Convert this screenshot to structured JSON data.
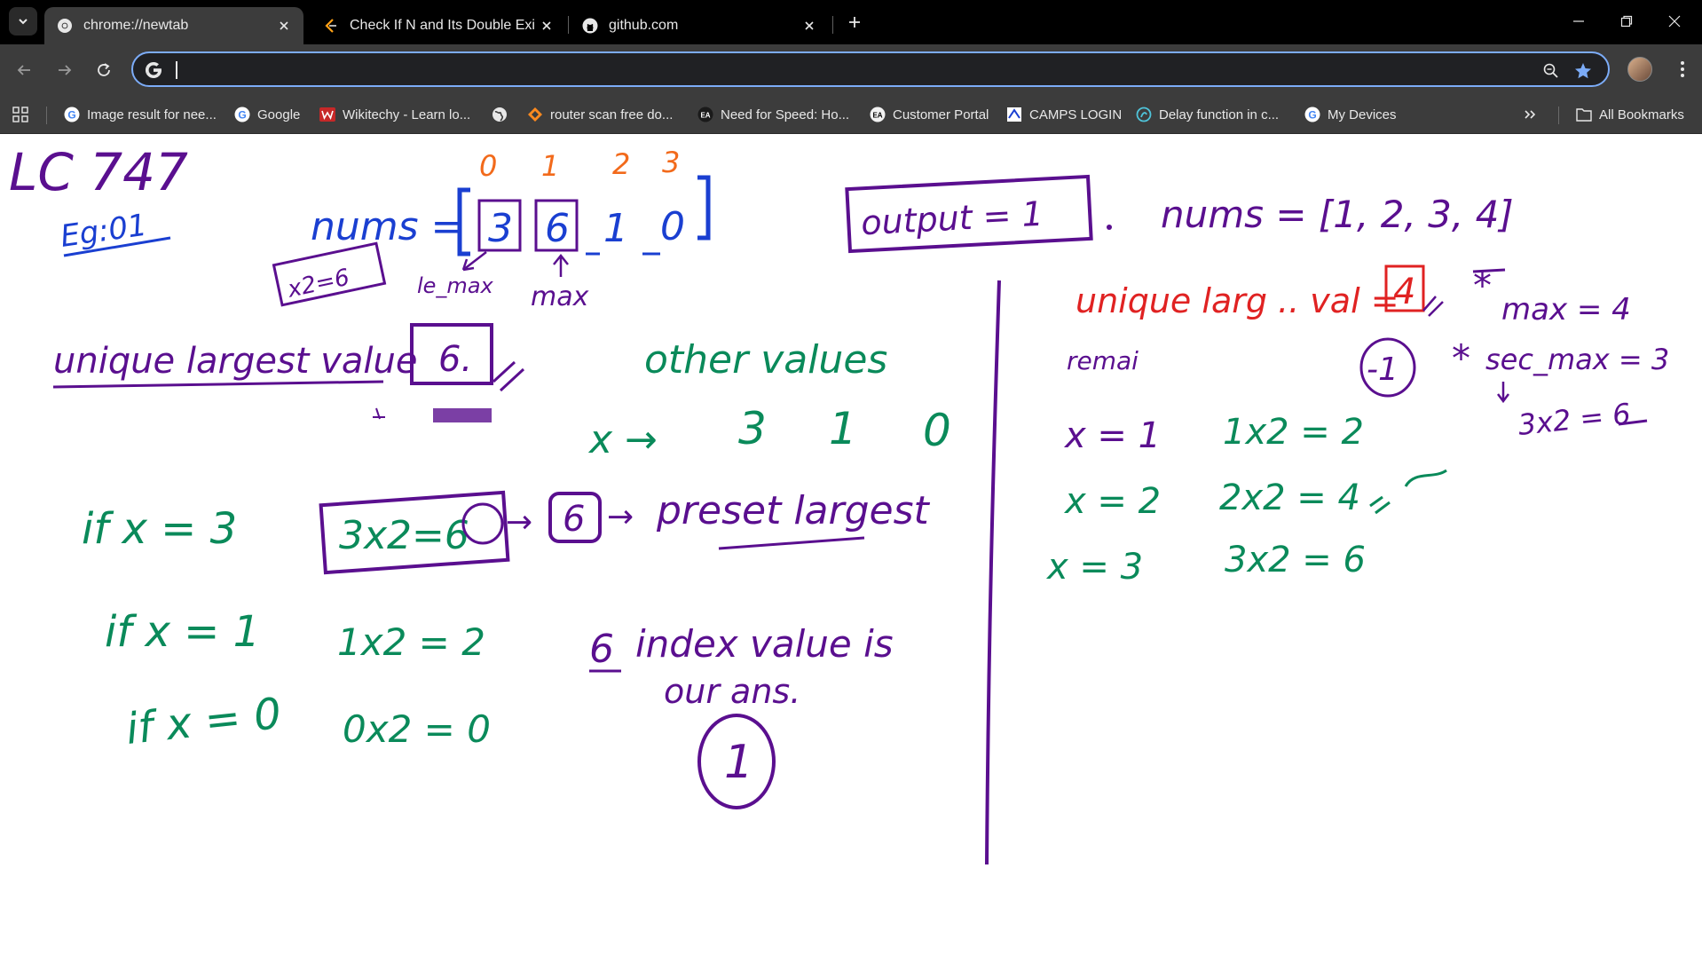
{
  "browser": {
    "tabs": [
      {
        "title": "chrome://newtab",
        "active": true,
        "icon": "chrome-icon"
      },
      {
        "title": "Check If N and Its Double Exist",
        "active": false,
        "icon": "leetcode-icon"
      },
      {
        "title": "github.com",
        "active": false,
        "icon": "github-icon"
      }
    ],
    "omnibox": {
      "value": "",
      "placeholder": ""
    },
    "bookmarks": [
      {
        "label": "Image result for nee...",
        "icon": "google-icon"
      },
      {
        "label": "Google",
        "icon": "google-icon"
      },
      {
        "label": "Wikitechy - Learn lo...",
        "icon": "wikitechy-icon"
      },
      {
        "label": "",
        "icon": "globe-icon"
      },
      {
        "label": "router scan free do...",
        "icon": "router-icon"
      },
      {
        "label": "Need for Speed: Ho...",
        "icon": "ea-icon"
      },
      {
        "label": "Customer Portal",
        "icon": "ea-icon"
      },
      {
        "label": "CAMPS LOGIN",
        "icon": "camps-icon"
      },
      {
        "label": "Delay function in c...",
        "icon": "delay-icon"
      },
      {
        "label": "My Devices",
        "icon": "google-icon"
      }
    ],
    "all_bookmarks": "All Bookmarks"
  },
  "colors": {
    "purple": "#5a0f8f",
    "blue": "#1a3fd1",
    "green": "#0a8a5a",
    "orange": "#f26a1b",
    "red": "#e02222"
  },
  "whiteboard": {
    "title": "LC 747",
    "example": "Eg:01",
    "indices": [
      "0",
      "1",
      "2",
      "3"
    ],
    "nums_label": "nums =",
    "nums": [
      "3",
      "6",
      "1",
      "0"
    ],
    "check_box": "x2=6",
    "le_max": "le_max",
    "max": "max",
    "output": "output = 1",
    "unique_largest": "unique largest value",
    "unique_val": "6.",
    "other_values": "other values",
    "x_arrow": "x →",
    "others": [
      "3",
      "1",
      "0"
    ],
    "if_x3": "if x = 3",
    "calc_3": "3x2=6",
    "boxed_6": "6",
    "arrow_text": "→",
    "preset_largest": "preset largest",
    "if_x1": "if x = 1",
    "calc_1": "1x2 = 2",
    "if_x0": "if x = 0",
    "calc_0": "0x2 = 0",
    "index_6": "6",
    "index_text": "index value is",
    "our_ans": "our ans.",
    "ans_circle": "1",
    "nums2": "nums = [1, 2, 3, 4]",
    "unique_larg_val": "unique larg .. val =",
    "val4": "4",
    "remain": "remai",
    "neg1": "-1",
    "max_eq": "max = 4",
    "sec_max": "sec_max = 3",
    "sec_calc": "3x2 = 6",
    "rx1": "x = 1",
    "rx2": "x = 2",
    "rx3": "x = 3",
    "rc1": "1x2 = 2",
    "rc2": "2x2 = 4",
    "rc3": "3x2 = 6"
  }
}
